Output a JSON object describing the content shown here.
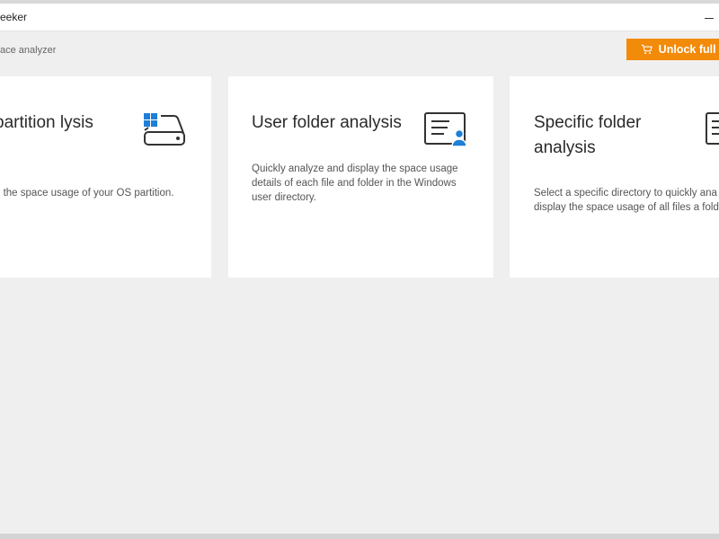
{
  "window": {
    "title": "eeker",
    "subtitle": "ace analyzer"
  },
  "header": {
    "unlock_label": "Unlock full v",
    "unlock_icon": "cart-icon",
    "accent_color": "#f28a0a"
  },
  "cards": [
    {
      "title": "partition lysis",
      "description": "e the space usage of your OS partition.",
      "icon": "drive-windows-icon"
    },
    {
      "title": "User folder analysis",
      "description": "Quickly analyze and display the space usage details of each file and folder in the Windows user directory.",
      "icon": "user-folder-icon"
    },
    {
      "title": "Specific folder analysis",
      "description": "Select a specific directory to quickly ana and display the space usage of all files a folders.",
      "icon": "folder-document-icon"
    }
  ]
}
